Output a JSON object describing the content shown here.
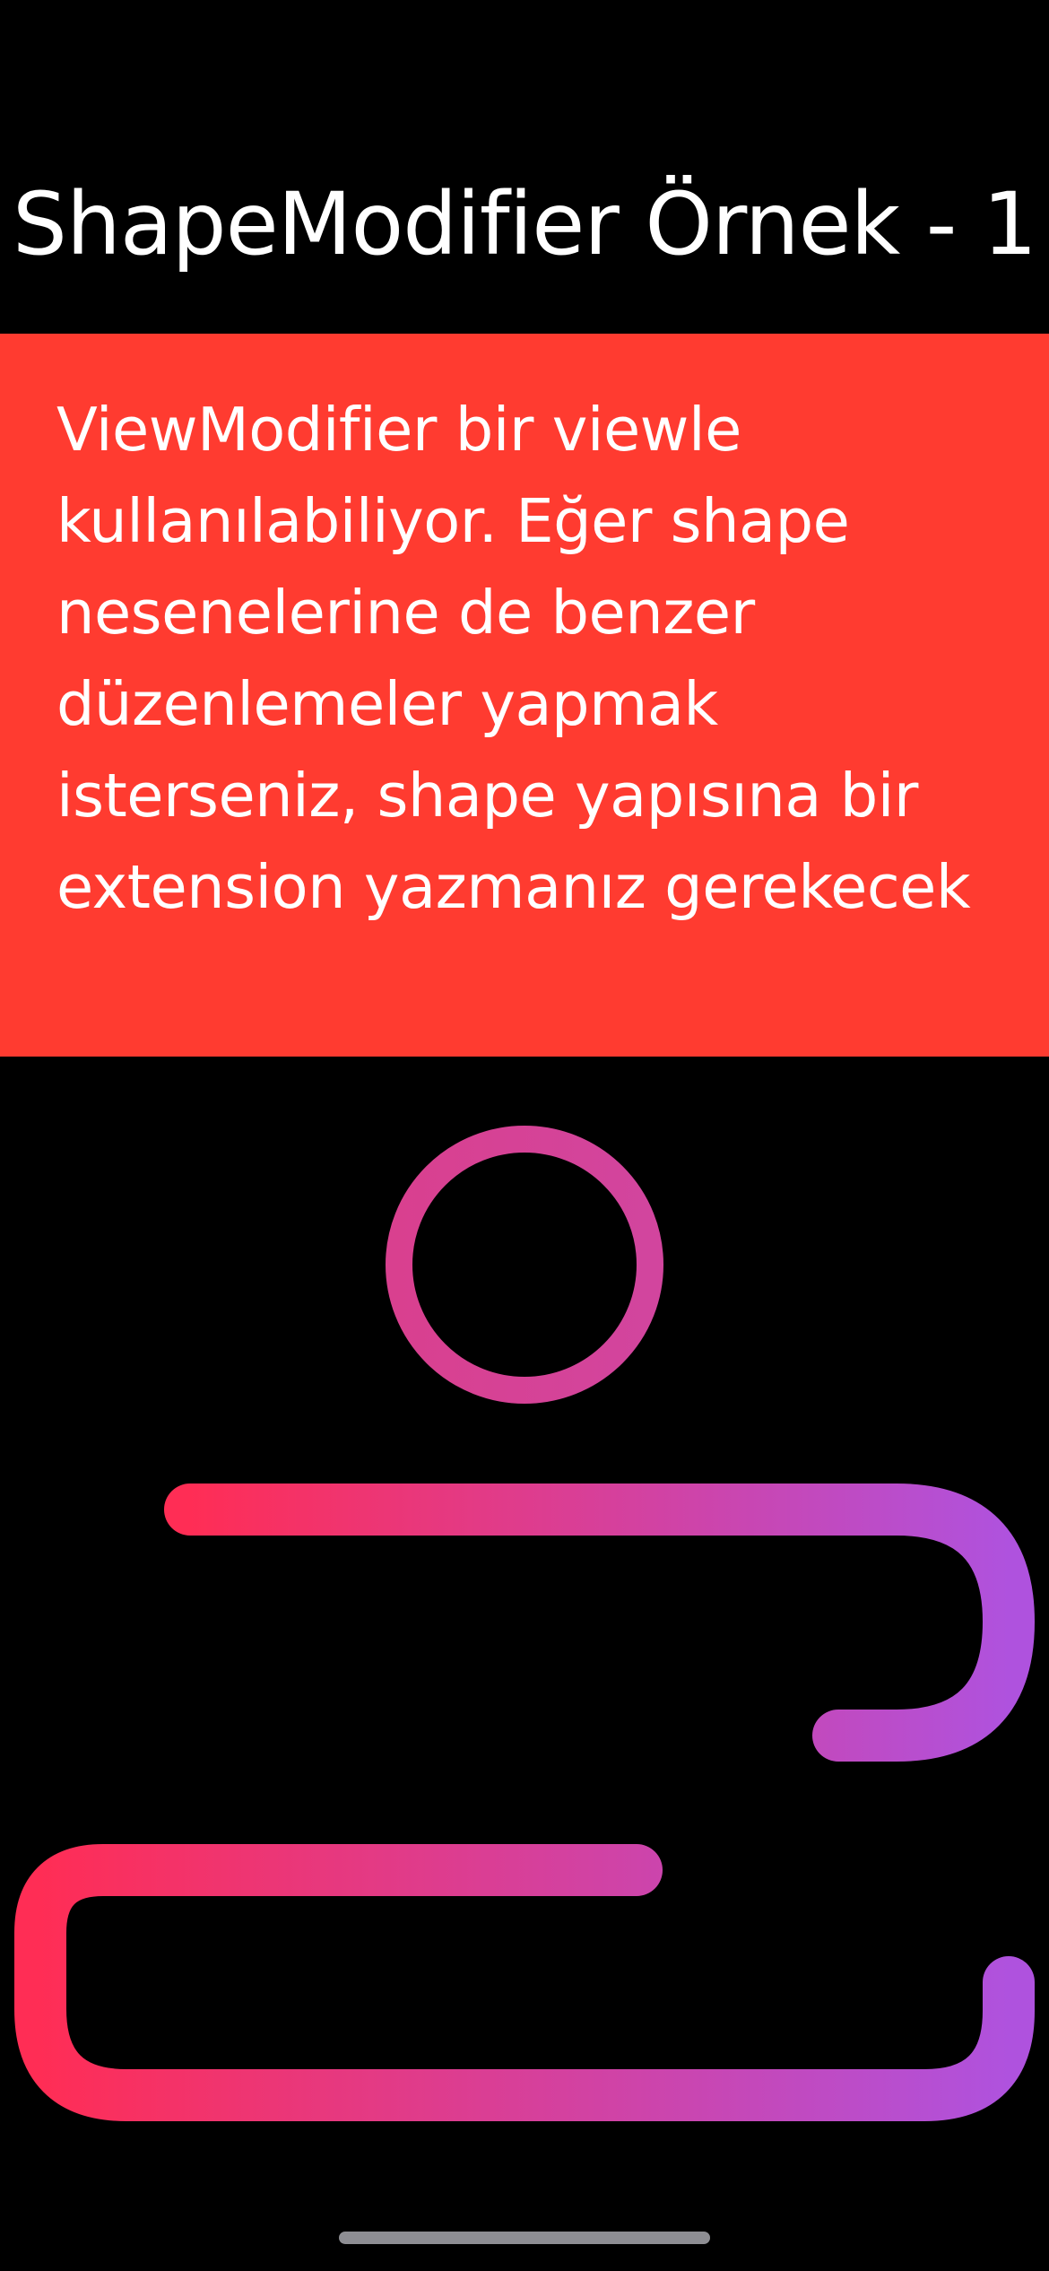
{
  "header": {
    "title": "ShapeModifier Örnek - 1"
  },
  "banner": {
    "text": "ViewModifier bir viewle kullanılabiliyor. Eğer shape nesenelerine de benzer düzenlemeler yapmak isterseniz, shape yapısına bir extension yazmanız gerekecek",
    "background_color": "#FF3B30",
    "text_color": "#FFFFFF"
  },
  "gradient": {
    "start_color": "#FF2D55",
    "end_color": "#AF52DE"
  }
}
